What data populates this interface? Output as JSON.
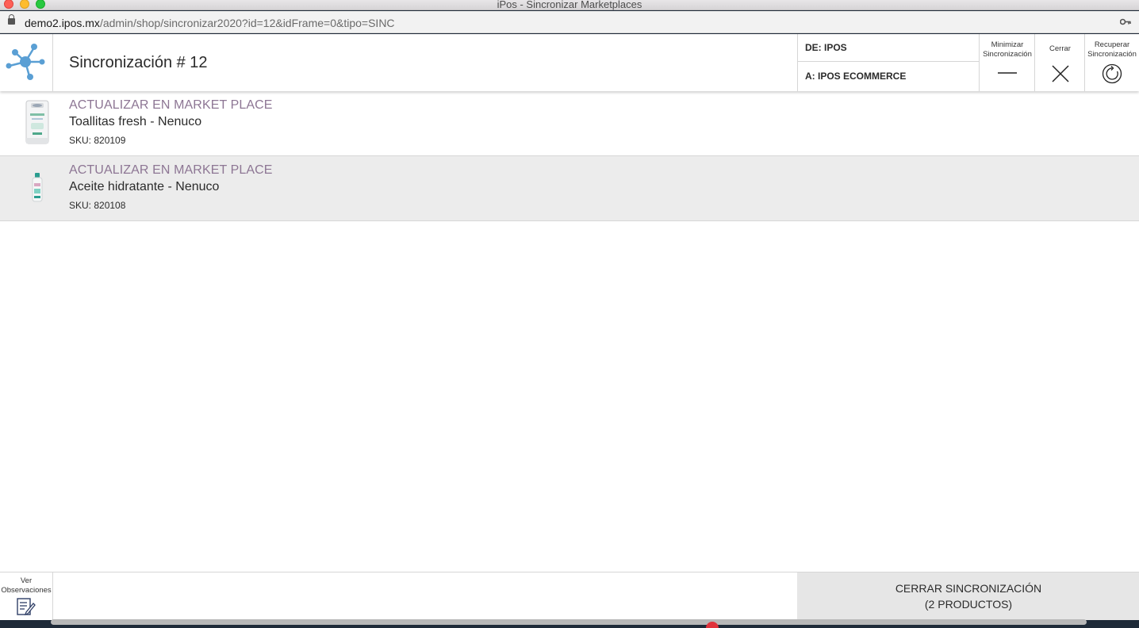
{
  "window": {
    "title": "iPos - Sincronizar Marketplaces"
  },
  "urlbar": {
    "host": "demo2.ipos.mx",
    "path": "/admin/shop/sincronizar2020?id=12&idFrame=0&tipo=SINC"
  },
  "header": {
    "title": "Sincronización # 12",
    "from": "DE: IPOS",
    "to": "A: IPOS ECOMMERCE",
    "minimize_label": "Minimizar Sincronización",
    "close_label": "Cerrar",
    "recover_label": "Recuperar Sincronización"
  },
  "items": [
    {
      "action": "ACTUALIZAR EN MARKET PLACE",
      "name": "Toallitas fresh - Nenuco",
      "sku": "SKU: 820109"
    },
    {
      "action": "ACTUALIZAR EN MARKET PLACE",
      "name": "Aceite hidratante - Nenuco",
      "sku": "SKU: 820108"
    }
  ],
  "footer": {
    "observations_label": "Ver Observaciones",
    "close_sync_line1": "CERRAR SINCRONIZACIÓN",
    "close_sync_line2": "(2 PRODUCTOS)"
  },
  "colors": {
    "accent": "#5a9fd4",
    "action_text": "#8d7694",
    "alt_row": "#ececec"
  },
  "icons": [
    "lock-icon",
    "key-icon",
    "network-logo-icon",
    "minimize-icon",
    "close-icon",
    "refresh-icon",
    "notes-edit-icon"
  ]
}
